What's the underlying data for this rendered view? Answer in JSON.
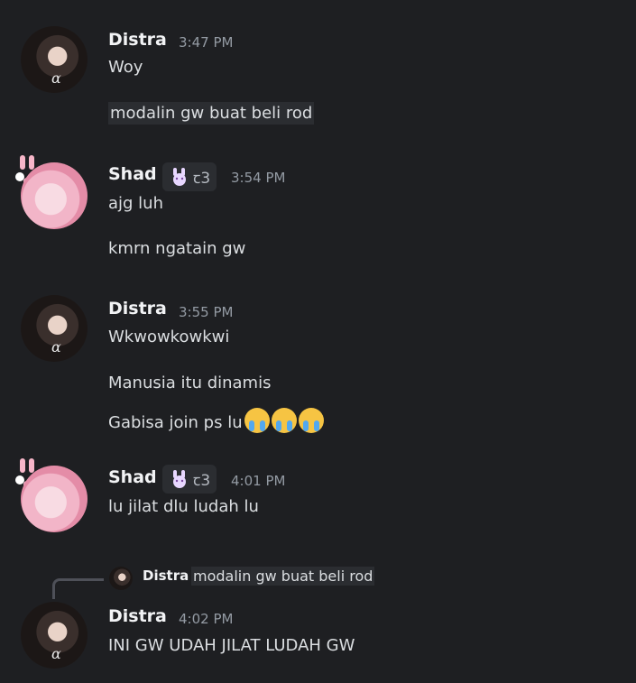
{
  "messages": [
    {
      "author": "Distra",
      "time": "3:47 PM",
      "lines": [
        "Woy",
        "modalin gw buat beli rod"
      ]
    },
    {
      "author": "Shad",
      "time": "3:54 PM",
      "lines": [
        "ajg luh",
        "kmrn ngatain gw"
      ]
    },
    {
      "author": "Distra",
      "time": "3:55 PM",
      "lines": [
        "Wkwowkowkwi",
        "Manusia itu dinamis",
        "Gabisa join ps lu"
      ]
    },
    {
      "author": "Shad",
      "time": "4:01 PM",
      "lines": [
        "lu jilat dlu ludah lu"
      ]
    },
    {
      "author": "Distra",
      "time": "4:02 PM",
      "lines": [
        "INI GW UDAH JILAT LUDAH GW"
      ]
    }
  ],
  "reply": {
    "author": "Distra",
    "text": "modalin gw buat beli rod"
  },
  "shad_badge": {
    "icon": "bunny-badge-icon",
    "text": "ꞇ3"
  },
  "emoji": "crying-face-icon"
}
